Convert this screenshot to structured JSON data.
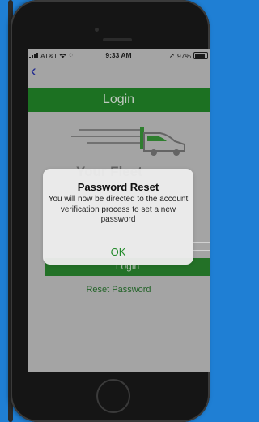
{
  "status_bar": {
    "carrier": "AT&T",
    "time": "9:33 AM",
    "battery": "97%"
  },
  "nav": {
    "back_icon": "chevron-left-icon"
  },
  "header": {
    "title": "Login"
  },
  "logo": {
    "text": "Your Fleet"
  },
  "login_button": {
    "label": "Login"
  },
  "reset_link": {
    "label": "Reset Password"
  },
  "alert": {
    "title": "Password Reset",
    "message": "You will now be directed to the account verification process to set a new password",
    "ok_label": "OK"
  },
  "colors": {
    "brand_green": "#238a2a",
    "link_blue": "#2a35b0",
    "background": "#1f7fd4"
  }
}
